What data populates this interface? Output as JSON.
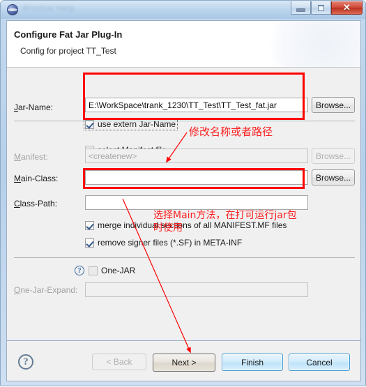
{
  "window": {
    "title_obscured": "Window   Help",
    "app_icon": "eclipse-sphere-icon",
    "minimize_label": "",
    "maximize_label": "",
    "close_label": "✕"
  },
  "wizard": {
    "title": "Configure Fat Jar Plug-In",
    "subtitle": "Config for project TT_Test"
  },
  "form": {
    "jar_name_label": "Jar-Name:",
    "jar_name_value": "E:\\WorkSpace\\trank_1230\\TT_Test\\TT_Test_fat.jar",
    "jar_name_browse": "Browse...",
    "use_extern_label": "use extern Jar-Name",
    "use_extern_checked": true,
    "select_manifest_label": "select Manifest file",
    "select_manifest_checked": false,
    "manifest_label": "Manifest:",
    "manifest_value": "<createnew>",
    "manifest_browse": "Browse...",
    "main_class_label": "Main-Class:",
    "main_class_value": "",
    "main_class_browse": "Browse...",
    "class_path_label": "Class-Path:",
    "class_path_value": "",
    "merge_sections_label": "merge individual sections of all MANIFEST.MF files",
    "merge_sections_checked": true,
    "remove_signer_label": "remove signer files (*.SF) in META-INF",
    "remove_signer_checked": true,
    "one_jar_label": "One-JAR",
    "one_jar_checked": false,
    "one_jar_help": "?",
    "one_jar_expand_label": "One-Jar-Expand:",
    "one_jar_expand_value": ""
  },
  "footer": {
    "help": "?",
    "back": "< Back",
    "next": "Next >",
    "finish": "Finish",
    "cancel": "Cancel"
  },
  "annotations": {
    "note_jar_name": "修改名称或者路径",
    "note_main_class_line1": "选择Main方法，在打可运行jar包",
    "note_main_class_line2": "时使用",
    "highlight_color": "#fe0000",
    "text_color": "#fb2020"
  }
}
